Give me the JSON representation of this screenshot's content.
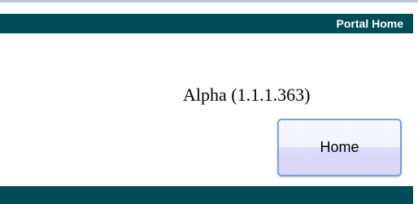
{
  "header": {
    "portal_home_label": "Portal Home",
    "bar_color": "#004d57"
  },
  "main": {
    "version_text": "Alpha (1.1.1.363)",
    "home_button_label": "Home"
  },
  "footer": {
    "bar_color": "#004d57"
  }
}
